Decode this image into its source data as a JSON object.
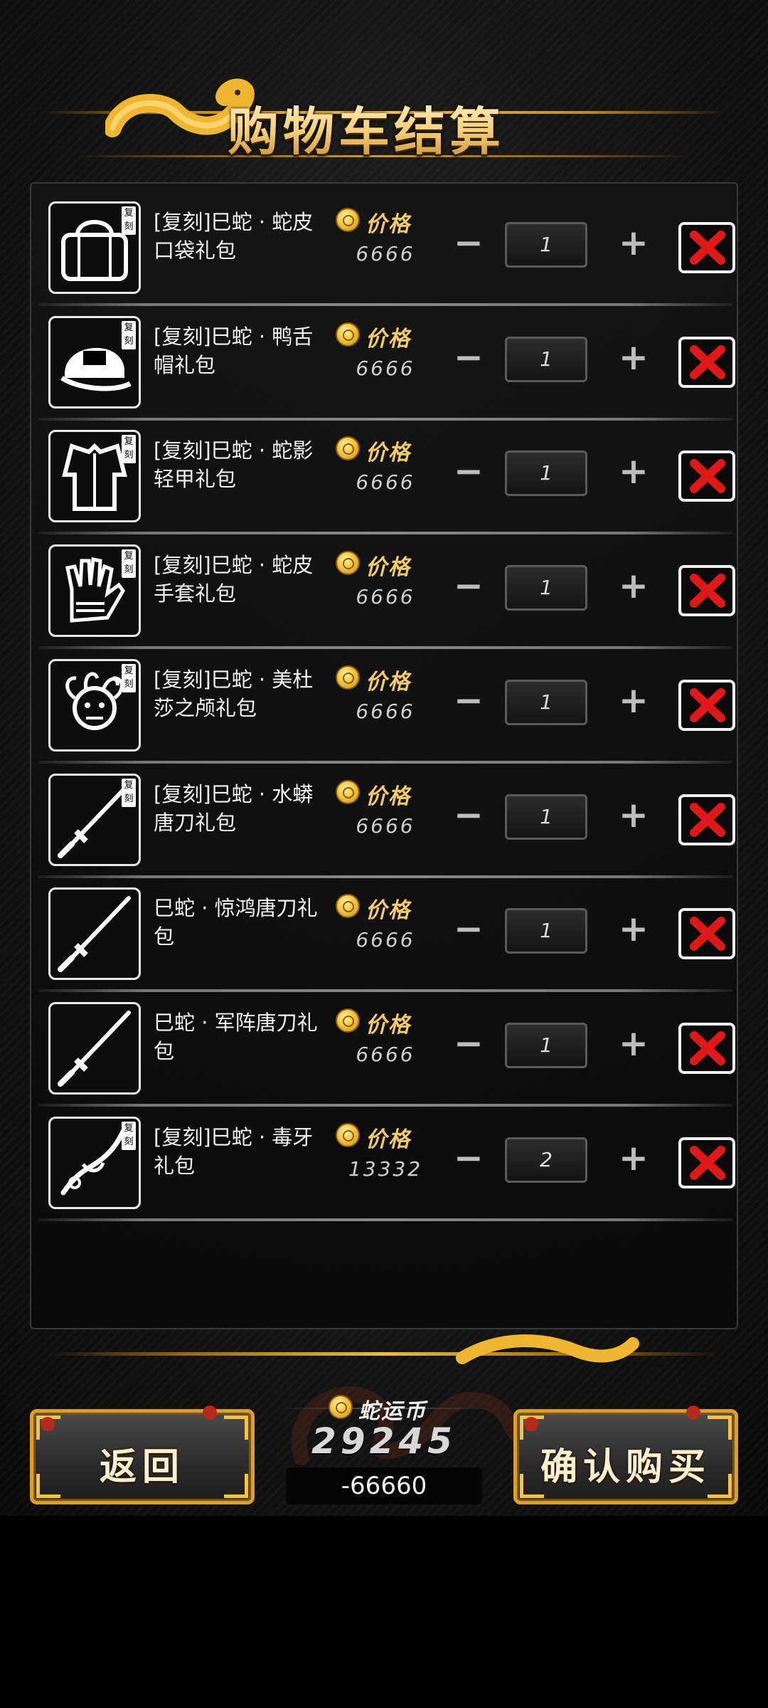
{
  "header": {
    "title": "购物车结算"
  },
  "cart": {
    "price_label": "价格",
    "badge_text": "复刻",
    "items": [
      {
        "name": "[复刻]巳蛇 · 蛇皮口袋礼包",
        "price": "6666",
        "qty": "1",
        "thumb_icon": "bag-icon",
        "badge": true
      },
      {
        "name": "[复刻]巳蛇 · 鸭舌帽礼包",
        "price": "6666",
        "qty": "1",
        "thumb_icon": "cap-icon",
        "badge": true
      },
      {
        "name": "[复刻]巳蛇 · 蛇影轻甲礼包",
        "price": "6666",
        "qty": "1",
        "thumb_icon": "armor-icon",
        "badge": true
      },
      {
        "name": "[复刻]巳蛇 · 蛇皮手套礼包",
        "price": "6666",
        "qty": "1",
        "thumb_icon": "gloves-icon",
        "badge": true
      },
      {
        "name": "[复刻]巳蛇 · 美杜莎之颅礼包",
        "price": "6666",
        "qty": "1",
        "thumb_icon": "medusa-head-icon",
        "badge": true
      },
      {
        "name": "[复刻]巳蛇 · 水蟒唐刀礼包",
        "price": "6666",
        "qty": "1",
        "thumb_icon": "tang-sword-icon",
        "badge": true
      },
      {
        "name": "巳蛇 · 惊鸿唐刀礼包",
        "price": "6666",
        "qty": "1",
        "thumb_icon": "tang-sword-icon",
        "badge": false
      },
      {
        "name": "巳蛇 · 军阵唐刀礼包",
        "price": "6666",
        "qty": "1",
        "thumb_icon": "tang-sword-icon",
        "badge": false
      },
      {
        "name": "[复刻]巳蛇 · 毒牙礼包",
        "price": "13332",
        "qty": "2",
        "thumb_icon": "fang-blade-icon",
        "badge": true
      }
    ]
  },
  "footer": {
    "back_label": "返回",
    "confirm_label": "确认购买",
    "currency_label": "蛇运币",
    "balance": "29245",
    "total_cost": "-66660"
  },
  "colors": {
    "accent_gold": "#f3c247",
    "delete_red": "#e01818",
    "panel_bg": "#141414"
  }
}
